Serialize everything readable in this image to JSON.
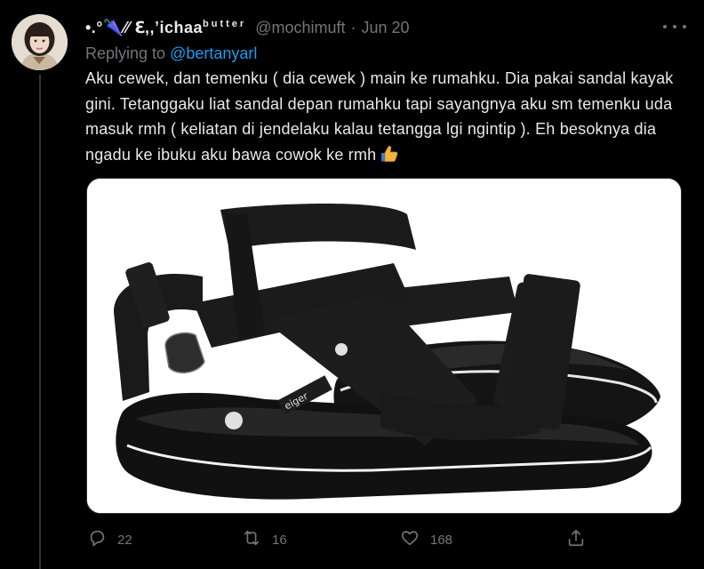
{
  "tweet": {
    "display_name": "•.°🌂⁄⁄ ℇ,,ʼichaa",
    "display_name_sup": "butter",
    "handle": "@mochimuft",
    "separator": "·",
    "date": "Jun 20",
    "replying_prefix": "Replying to",
    "replying_to": "@bertanyarl",
    "text": "Aku cewek, dan temenku ( dia cewek ) main ke rumahku. Dia pakai sandal kayak gini. Tetanggaku liat sandal depan rumahku tapi sayangnya aku sm temenku uda masuk rmh ( keliatan di jendelaku kalau tetangga lgi ngintip ). Eh besoknya dia ngadu ke ibuku aku bawa cowok ke rmh",
    "emoji_icon": "thumbs-up-icon",
    "image_alt": "black sandals",
    "sandal_brand_text": "eiger"
  },
  "actions": {
    "reply_count": "22",
    "retweet_count": "16",
    "like_count": "168"
  },
  "colors": {
    "background": "#000000",
    "text": "#e7e9ea",
    "muted": "#71767b",
    "link": "#1d9bf0"
  }
}
